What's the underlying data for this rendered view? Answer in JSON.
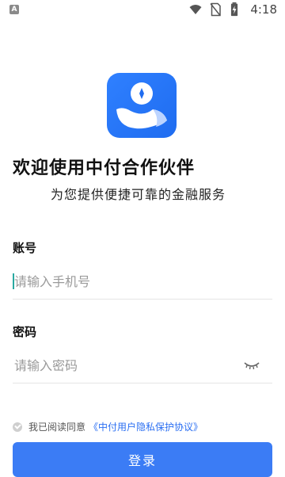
{
  "status_bar": {
    "left_icon_label": "A",
    "time": "4:18",
    "icons": [
      "wifi-icon",
      "sim-blocked-icon",
      "battery-charging-icon"
    ]
  },
  "header": {
    "welcome_title": "欢迎使用中付合作伙伴",
    "subtitle": "为您提供便捷可靠的金融服务"
  },
  "form": {
    "account_label": "账号",
    "account_placeholder": "请输入手机号",
    "account_value": "",
    "password_label": "密码",
    "password_placeholder": "请输入密码",
    "password_value": ""
  },
  "agreement": {
    "prefix": "我已阅读同意",
    "link_text": "《中付用户隐私保护协议》",
    "checked": false
  },
  "login_button": {
    "label": "登录"
  },
  "colors": {
    "accent": "#3b7cf5",
    "link": "#2b6ff2"
  }
}
